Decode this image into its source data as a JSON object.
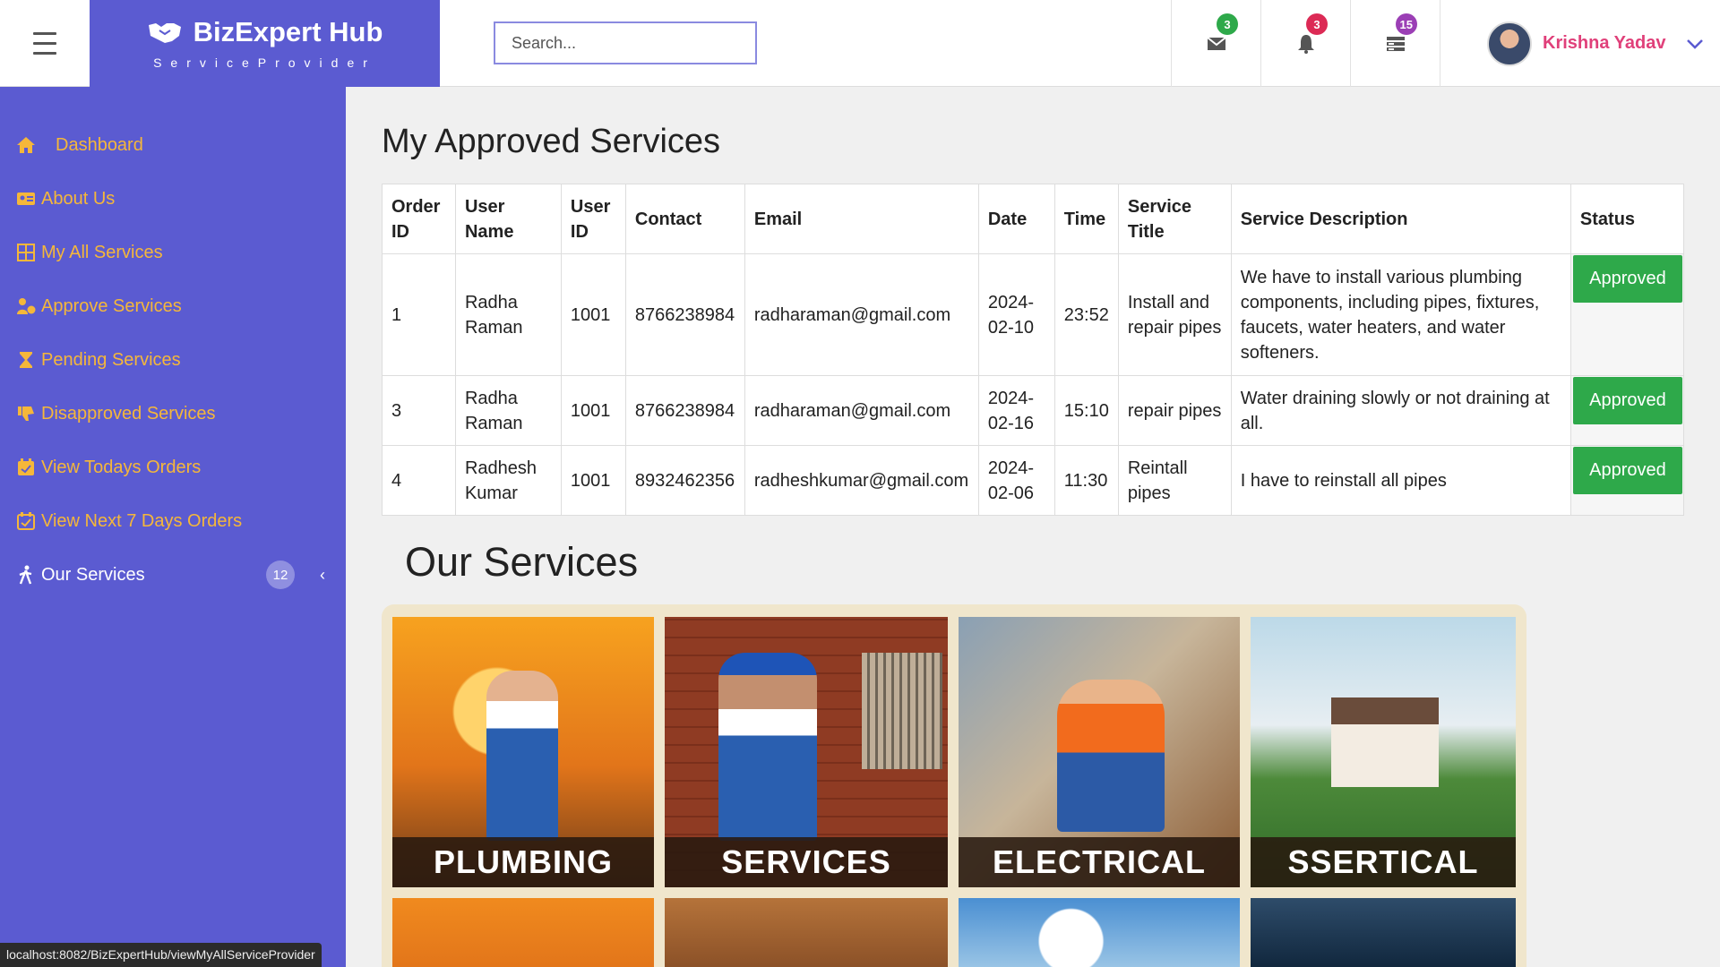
{
  "header": {
    "brand_title": "BizExpert Hub",
    "brand_subtitle": "ServiceProvider",
    "search_placeholder": "Search...",
    "messages_count": "3",
    "notifications_count": "3",
    "tasks_count": "15",
    "user_name": "Krishna Yadav"
  },
  "sidebar": {
    "items": [
      {
        "label": "Dashboard",
        "icon": "home-icon"
      },
      {
        "label": "About Us",
        "icon": "id-card-icon"
      },
      {
        "label": "My All Services",
        "icon": "grid-icon"
      },
      {
        "label": "Approve Services",
        "icon": "user-check-icon"
      },
      {
        "label": "Pending Services",
        "icon": "hourglass-icon"
      },
      {
        "label": "Disapproved Services",
        "icon": "thumbs-down-icon"
      },
      {
        "label": "View Todays Orders",
        "icon": "calendar-check-icon"
      },
      {
        "label": "View Next 7 Days Orders",
        "icon": "calendar-check-icon"
      },
      {
        "label": "Our Services",
        "icon": "walking-person-icon",
        "badge": "12"
      }
    ]
  },
  "main": {
    "title": "My Approved Services",
    "table": {
      "headers": [
        "Order ID",
        "User Name",
        "User ID",
        "Contact",
        "Email",
        "Date",
        "Time",
        "Service Title",
        "Service Description",
        "Status"
      ],
      "rows": [
        {
          "order_id": "1",
          "user_name": "Radha Raman",
          "user_id": "1001",
          "contact": "8766238984",
          "email": "radharaman@gmail.com",
          "date": "2024-02-10",
          "time": "23:52",
          "service_title": "Install and repair pipes",
          "description": "We have to install various plumbing components, including pipes, fixtures, faucets, water heaters, and water softeners.",
          "status": "Approved"
        },
        {
          "order_id": "3",
          "user_name": "Radha Raman",
          "user_id": "1001",
          "contact": "8766238984",
          "email": "radharaman@gmail.com",
          "date": "2024-02-16",
          "time": "15:10",
          "service_title": "repair pipes",
          "description": "Water draining slowly or not draining at all.",
          "status": "Approved"
        },
        {
          "order_id": "4",
          "user_name": "Radhesh Kumar",
          "user_id": "1001",
          "contact": "8932462356",
          "email": "radheshkumar@gmail.com",
          "date": "2024-02-06",
          "time": "11:30",
          "service_title": "Reintall pipes",
          "description": "I have to reinstall all pipes",
          "status": "Approved"
        }
      ]
    },
    "services_title": "Our Services",
    "gallery": [
      "PLUMBING",
      "SERVICES",
      "ELECTRICAL",
      "SSERTICAL"
    ]
  },
  "statusbar": {
    "url": "localhost:8082/BizExpertHub/viewMyAllServiceProvider"
  },
  "colors": {
    "brand": "#5b5bd1",
    "sidebar_text": "#f5b73a",
    "approved": "#2ea94a",
    "user_name": "#e0407a"
  }
}
